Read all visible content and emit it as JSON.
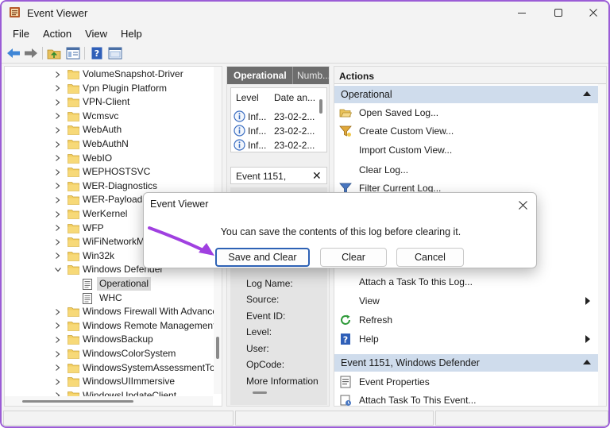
{
  "window": {
    "title": "Event Viewer",
    "accent_border": "#9b5cd6"
  },
  "menu": [
    "File",
    "Action",
    "View",
    "Help"
  ],
  "toolbar_icons": [
    "back-arrow-icon",
    "forward-arrow-icon",
    "folder-up-icon",
    "show-hide-tree-icon",
    "help-icon",
    "properties-icon"
  ],
  "tree": {
    "items": [
      {
        "label": "VolumeSnapshot-Driver",
        "type": "folder",
        "expanded": false
      },
      {
        "label": "Vpn Plugin Platform",
        "type": "folder",
        "expanded": false
      },
      {
        "label": "VPN-Client",
        "type": "folder",
        "expanded": false
      },
      {
        "label": "Wcmsvc",
        "type": "folder",
        "expanded": false
      },
      {
        "label": "WebAuth",
        "type": "folder",
        "expanded": false
      },
      {
        "label": "WebAuthN",
        "type": "folder",
        "expanded": false
      },
      {
        "label": "WebIO",
        "type": "folder",
        "expanded": false
      },
      {
        "label": "WEPHOSTSVC",
        "type": "folder",
        "expanded": false
      },
      {
        "label": "WER-Diagnostics",
        "type": "folder",
        "expanded": false
      },
      {
        "label": "WER-PayloadHealth",
        "type": "folder",
        "expanded": false
      },
      {
        "label": "WerKernel",
        "type": "folder",
        "expanded": false
      },
      {
        "label": "WFP",
        "type": "folder",
        "expanded": false
      },
      {
        "label": "WiFiNetworkManager",
        "type": "folder",
        "expanded": false
      },
      {
        "label": "Win32k",
        "type": "folder",
        "expanded": false
      },
      {
        "label": "Windows Defender",
        "type": "folder",
        "expanded": true
      },
      {
        "label": "Operational",
        "type": "log",
        "selected": true
      },
      {
        "label": "WHC",
        "type": "log"
      },
      {
        "label": "Windows Firewall With Advanced Security",
        "type": "folder",
        "expanded": false
      },
      {
        "label": "Windows Remote Management",
        "type": "folder",
        "expanded": false
      },
      {
        "label": "WindowsBackup",
        "type": "folder",
        "expanded": false
      },
      {
        "label": "WindowsColorSystem",
        "type": "folder",
        "expanded": false
      },
      {
        "label": "WindowsSystemAssessmentTool",
        "type": "folder",
        "expanded": false
      },
      {
        "label": "WindowsUIImmersive",
        "type": "folder",
        "expanded": false
      },
      {
        "label": "WindowsUpdateClient",
        "type": "folder",
        "expanded": false
      }
    ]
  },
  "middle": {
    "tab_active": "Operational",
    "tab_other": "Numb...",
    "columns": [
      "Level",
      "Date an..."
    ],
    "events": [
      {
        "level": "Inf...",
        "date": "23-02-2..."
      },
      {
        "level": "Inf...",
        "date": "23-02-2..."
      },
      {
        "level": "Inf...",
        "date": "23-02-2..."
      }
    ],
    "detail_title": "Event 1151,",
    "detail_fields": [
      "Log Name:",
      "Source:",
      "Event ID:",
      "Level:",
      "User:",
      "OpCode:",
      "More Information"
    ]
  },
  "actions": {
    "header": "Actions",
    "sections": [
      {
        "label": "Operational",
        "items": [
          {
            "label": "Open Saved Log...",
            "icon": "open-folder-icon"
          },
          {
            "label": "Create Custom View...",
            "icon": "filter-funnel-icon"
          },
          {
            "label": "Import Custom View...",
            "icon": "none"
          },
          {
            "label": "Clear Log...",
            "icon": "none"
          },
          {
            "label": "Filter Current Log...",
            "icon": "filter-funnel-icon"
          },
          {
            "label": "Attach a Task To this Log...",
            "icon": "none"
          },
          {
            "label": "View",
            "icon": "none",
            "submenu": true
          },
          {
            "label": "Refresh",
            "icon": "refresh-icon"
          },
          {
            "label": "Help",
            "icon": "help-icon",
            "submenu": true
          }
        ]
      },
      {
        "label": "Event 1151, Windows Defender",
        "items": [
          {
            "label": "Event Properties",
            "icon": "event-properties-icon"
          },
          {
            "label": "Attach Task To This Event...",
            "icon": "attach-task-icon"
          }
        ]
      }
    ]
  },
  "dialog": {
    "title": "Event Viewer",
    "message": "You can save the contents of this log before clearing it.",
    "buttons": {
      "save_and_clear": "Save and Clear",
      "clear": "Clear",
      "cancel": "Cancel"
    },
    "annotation_color": "#a040e0"
  }
}
